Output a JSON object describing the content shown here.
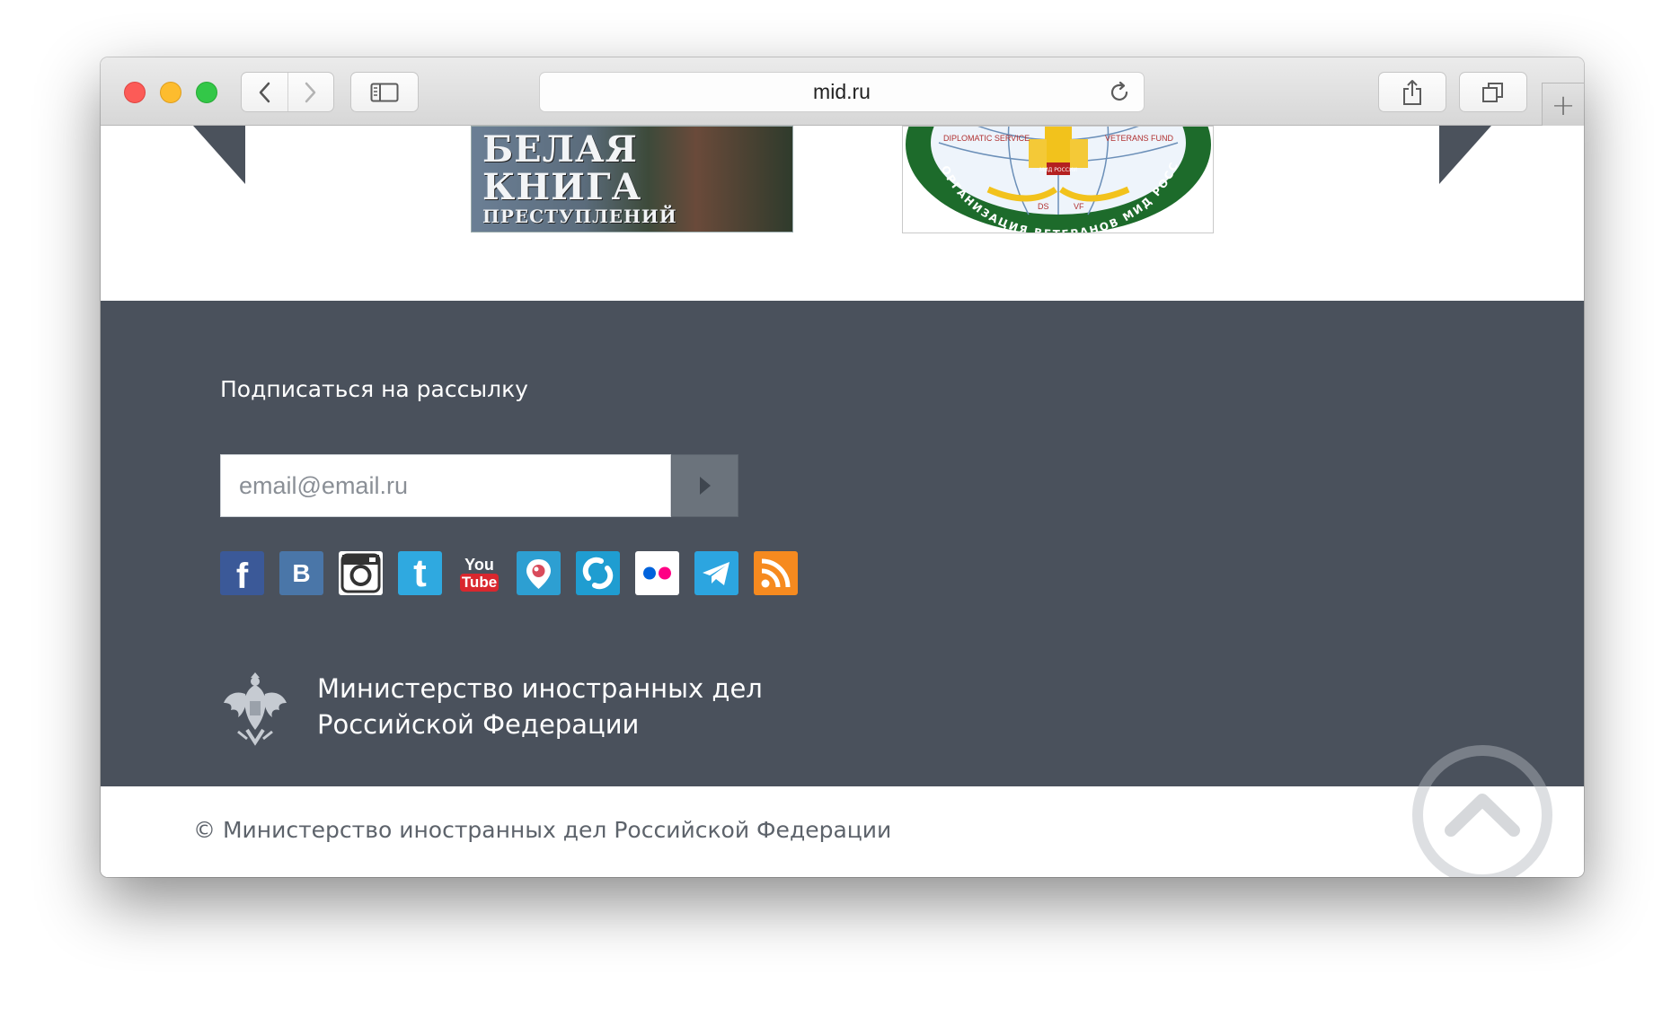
{
  "browser": {
    "url": "mid.ru",
    "traffic_lights": [
      "close",
      "minimize",
      "maximize"
    ],
    "toolbar_icons": [
      "back-icon",
      "forward-icon",
      "sidebar-icon",
      "reload-icon",
      "share-icon",
      "tabs-icon",
      "new-tab-icon"
    ],
    "new_tab_label": "+"
  },
  "carousel": {
    "banner1": {
      "line1": "БЕЛАЯ",
      "line2": "КНИГА",
      "line3": "ПРЕСТУПЛЕНИЙ"
    },
    "banner2": {
      "top_left": "DIPLOMATIC SERVICE",
      "top_right": "VETERANS FUND",
      "center": "МИД РОССИИ",
      "bottom_left": "DS",
      "bottom_right": "VF",
      "ring": "ОРГАНИЗАЦИЯ ВЕТЕРАНОВ МИД РОССИИ"
    }
  },
  "subscribe": {
    "title": "Подписаться на рассылку",
    "placeholder": "email@email.ru"
  },
  "socials": [
    {
      "name": "facebook",
      "label": "f",
      "color": "#3b5998"
    },
    {
      "name": "vkontakte",
      "label": "B",
      "color": "#4a76a8"
    },
    {
      "name": "instagram",
      "label": "",
      "color": "#ffffff"
    },
    {
      "name": "twitter",
      "label": "t",
      "color": "#2fa9e0"
    },
    {
      "name": "youtube",
      "label_top": "You",
      "label_bottom": "Tube",
      "color": "#d9272e"
    },
    {
      "name": "periscope",
      "label": "",
      "color": "#2d9fd2"
    },
    {
      "name": "livestream",
      "label": "",
      "color": "#1f9dd1"
    },
    {
      "name": "flickr",
      "label": "",
      "color": "#ffffff"
    },
    {
      "name": "telegram",
      "label": "",
      "color": "#2ca5e0"
    },
    {
      "name": "rss",
      "label": "",
      "color": "#f68a1f"
    }
  ],
  "ministry": {
    "line1": "Министерство иностранных дел",
    "line2": "Российской Федерации"
  },
  "copyright": "© Министерство иностранных дел Российской Федерации",
  "colors": {
    "footer_bg": "#4a515c",
    "accent_dark": "#4b525c",
    "submit_bg": "#6b737c"
  }
}
